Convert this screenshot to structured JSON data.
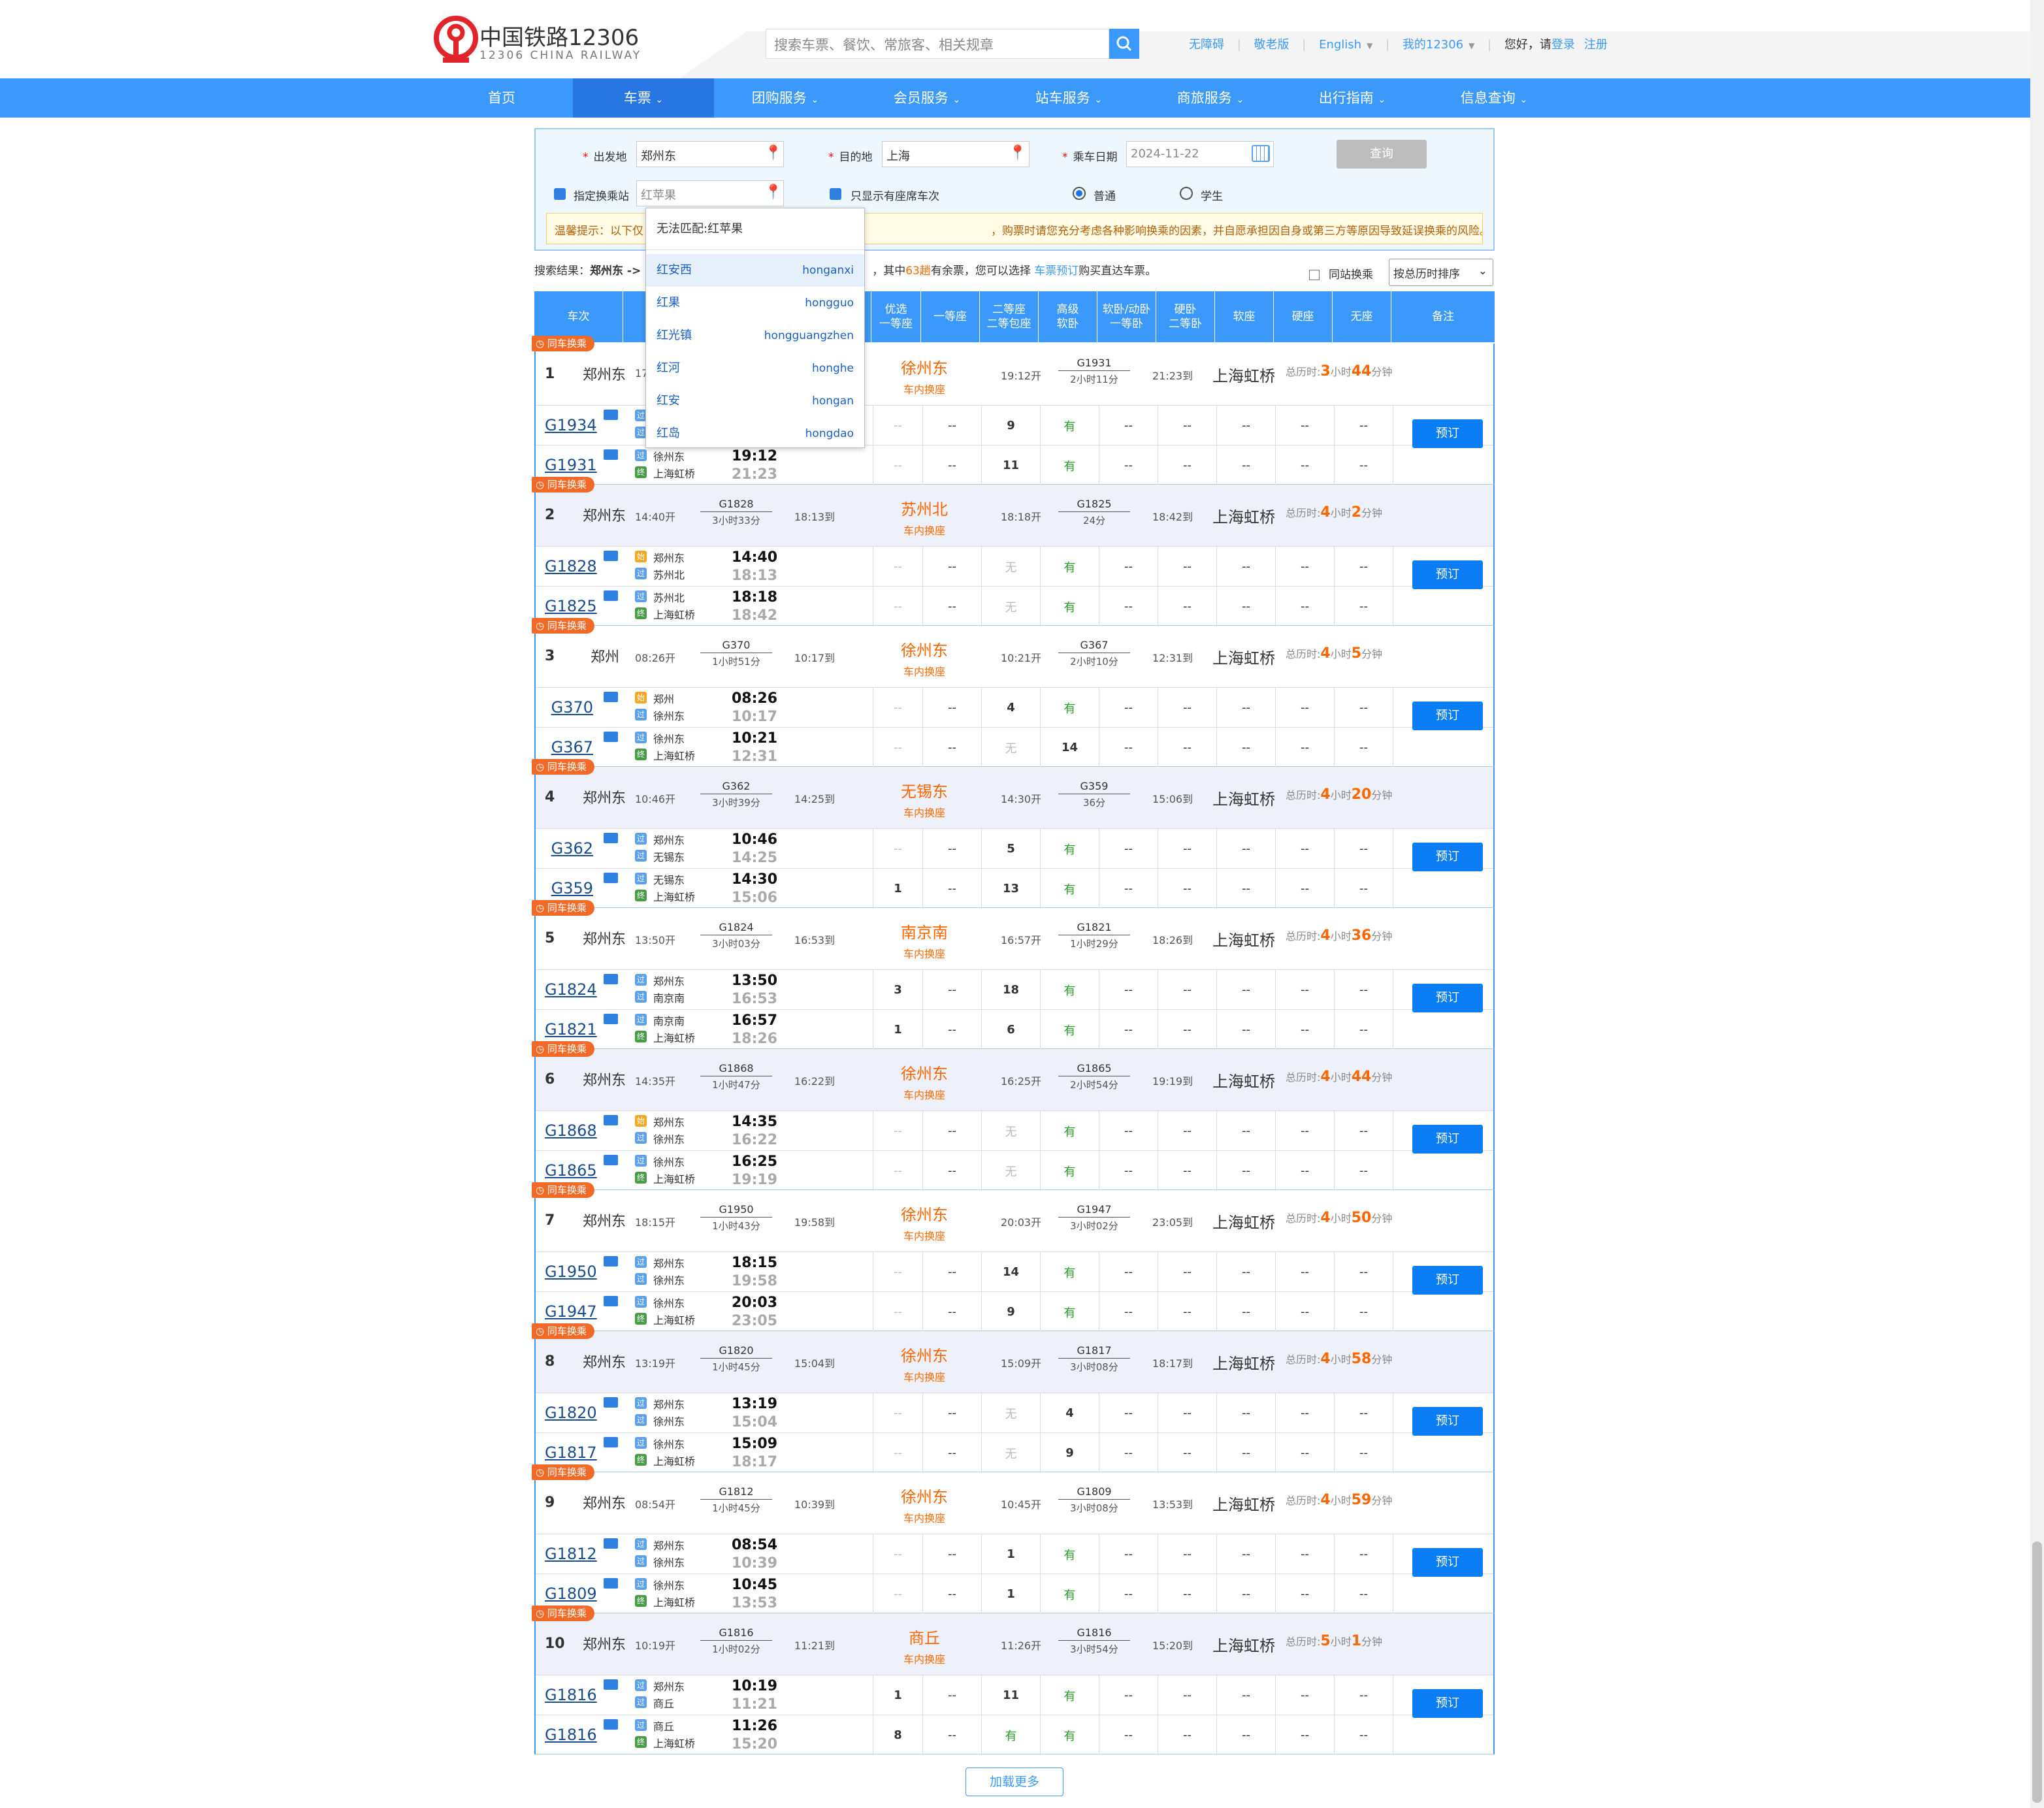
{
  "header": {
    "logo_cn": "中国铁路12306",
    "logo_en": "12306 CHINA RAILWAY",
    "search_placeholder": "搜索车票、餐饮、常旅客、相关规章",
    "links": [
      "无障碍",
      "敬老版",
      "English",
      "我的12306"
    ],
    "greeting": "您好，请",
    "login": "登录",
    "register": "注册"
  },
  "nav": [
    "首页",
    "车票",
    "团购服务",
    "会员服务",
    "站车服务",
    "商旅服务",
    "出行指南",
    "信息查询"
  ],
  "form": {
    "from_label": "出发地",
    "from_value": "郑州东",
    "to_label": "目的地",
    "to_value": "上海",
    "date_label": "乘车日期",
    "date_value": "2024-11-22",
    "query_button": "查询",
    "transfer_label": "指定换乘站",
    "transfer_value": "红苹果",
    "seat_only_label": "只显示有座席车次",
    "normal_label": "普通",
    "student_label": "学生",
    "tip": "温馨提示：以下仅",
    "tip_tail": "，购票时请您充分考虑各种影响换乘的因素，并自愿承担因自身或第三方等原因导致延误换乘的风险。"
  },
  "dropdown": {
    "header": "无法匹配:红苹果",
    "items": [
      {
        "name": "红安西",
        "py": "honganxi"
      },
      {
        "name": "红果",
        "py": "hongguo"
      },
      {
        "name": "红光镇",
        "py": "hongguangzhen"
      },
      {
        "name": "红河",
        "py": "honghe"
      },
      {
        "name": "红安",
        "py": "hongan"
      },
      {
        "name": "红岛",
        "py": "hongdao"
      }
    ]
  },
  "results": {
    "prefix": "搜索结果：",
    "route": "郑州东 ->",
    "mid1": "，其中",
    "count": "63趟",
    "mid2": "有余票，您可以选择",
    "link": "车票预订",
    "suffix": "购买直达车票。",
    "same_train_label": "同站换乘",
    "sort": "按总历时排序"
  },
  "columns": [
    "车次",
    "优选\n一等座",
    "一等座",
    "二等座\n二等包座",
    "高级\n软卧",
    "软卧/动卧\n一等卧",
    "硬卧\n二等卧",
    "软座",
    "硬座",
    "无座",
    "备注"
  ],
  "labels": {
    "badge": "同车换乘",
    "transfer_sub": "车内换座",
    "total_prefix": "总历时:",
    "dest": "上海虹桥",
    "book": "预订",
    "load_more": "加载更多"
  },
  "groups": [
    {
      "idx": "1",
      "orig": "郑州东",
      "dep": "17",
      "t1": "G1931",
      "d1": "2小时11分",
      "arr1": "",
      "xfer": "徐州东",
      "dep2": "19:12开",
      "t2": "G1931",
      "d2": "2小时11分",
      "arr2": "21:23到",
      "total_h": "3",
      "total_m": "44",
      "rows": [
        {
          "train": "G1934",
          "s1": "",
          "s2": "",
          "dt": "",
          "at": "",
          "seats": [
            "--",
            "--",
            "9",
            "有",
            "--",
            "--",
            "--",
            "--",
            "--",
            "--"
          ]
        },
        {
          "train": "G1931",
          "s1": "徐州东",
          "s2": "上海虹桥",
          "dt": "19:12",
          "at": "21:23",
          "seats": [
            "--",
            "--",
            "11",
            "有",
            "--",
            "--",
            "--",
            "--",
            "--",
            "--"
          ]
        }
      ]
    },
    {
      "idx": "2",
      "orig": "郑州东",
      "dep": "14:40开",
      "t1": "G1828",
      "d1": "3小时33分",
      "arr1": "18:13到",
      "xfer": "苏州北",
      "dep2": "18:18开",
      "t2": "G1825",
      "d2": "24分",
      "arr2": "18:42到",
      "total_h": "4",
      "total_m": "2",
      "rows": [
        {
          "train": "G1828",
          "s1": "郑州东",
          "s2": "苏州北",
          "dt": "14:40",
          "at": "18:13",
          "seats": [
            "--",
            "--",
            "无",
            "有",
            "--",
            "--",
            "--",
            "--",
            "--",
            "--"
          ]
        },
        {
          "train": "G1825",
          "s1": "苏州北",
          "s2": "上海虹桥",
          "dt": "18:18",
          "at": "18:42",
          "seats": [
            "--",
            "--",
            "无",
            "有",
            "--",
            "--",
            "--",
            "--",
            "--",
            "--"
          ]
        }
      ]
    },
    {
      "idx": "3",
      "orig": "郑州",
      "dep": "08:26开",
      "t1": "G370",
      "d1": "1小时51分",
      "arr1": "10:17到",
      "xfer": "徐州东",
      "dep2": "10:21开",
      "t2": "G367",
      "d2": "2小时10分",
      "arr2": "12:31到",
      "total_h": "4",
      "total_m": "5",
      "rows": [
        {
          "train": "G370",
          "s1": "郑州",
          "s2": "徐州东",
          "dt": "08:26",
          "at": "10:17",
          "seats": [
            "--",
            "--",
            "4",
            "有",
            "--",
            "--",
            "--",
            "--",
            "--",
            "--"
          ]
        },
        {
          "train": "G367",
          "s1": "徐州东",
          "s2": "上海虹桥",
          "dt": "10:21",
          "at": "12:31",
          "seats": [
            "--",
            "--",
            "无",
            "14",
            "--",
            "--",
            "--",
            "--",
            "--",
            "--"
          ]
        }
      ]
    },
    {
      "idx": "4",
      "orig": "郑州东",
      "dep": "10:46开",
      "t1": "G362",
      "d1": "3小时39分",
      "arr1": "14:25到",
      "xfer": "无锡东",
      "dep2": "14:30开",
      "t2": "G359",
      "d2": "36分",
      "arr2": "15:06到",
      "total_h": "4",
      "total_m": "20",
      "rows": [
        {
          "train": "G362",
          "s1": "郑州东",
          "s2": "无锡东",
          "dt": "10:46",
          "at": "14:25",
          "seats": [
            "--",
            "--",
            "5",
            "有",
            "--",
            "--",
            "--",
            "--",
            "--",
            "--"
          ]
        },
        {
          "train": "G359",
          "s1": "无锡东",
          "s2": "上海虹桥",
          "dt": "14:30",
          "at": "15:06",
          "seats": [
            "1",
            "--",
            "13",
            "有",
            "--",
            "--",
            "--",
            "--",
            "--",
            "--"
          ]
        }
      ]
    },
    {
      "idx": "5",
      "orig": "郑州东",
      "dep": "13:50开",
      "t1": "G1824",
      "d1": "3小时03分",
      "arr1": "16:53到",
      "xfer": "南京南",
      "dep2": "16:57开",
      "t2": "G1821",
      "d2": "1小时29分",
      "arr2": "18:26到",
      "total_h": "4",
      "total_m": "36",
      "rows": [
        {
          "train": "G1824",
          "s1": "郑州东",
          "s2": "南京南",
          "dt": "13:50",
          "at": "16:53",
          "seats": [
            "3",
            "--",
            "18",
            "有",
            "--",
            "--",
            "--",
            "--",
            "--",
            "--"
          ]
        },
        {
          "train": "G1821",
          "s1": "南京南",
          "s2": "上海虹桥",
          "dt": "16:57",
          "at": "18:26",
          "seats": [
            "1",
            "--",
            "6",
            "有",
            "--",
            "--",
            "--",
            "--",
            "--",
            "--"
          ]
        }
      ]
    },
    {
      "idx": "6",
      "orig": "郑州东",
      "dep": "14:35开",
      "t1": "G1868",
      "d1": "1小时47分",
      "arr1": "16:22到",
      "xfer": "徐州东",
      "dep2": "16:25开",
      "t2": "G1865",
      "d2": "2小时54分",
      "arr2": "19:19到",
      "total_h": "4",
      "total_m": "44",
      "rows": [
        {
          "train": "G1868",
          "s1": "郑州东",
          "s2": "徐州东",
          "dt": "14:35",
          "at": "16:22",
          "seats": [
            "--",
            "--",
            "无",
            "有",
            "--",
            "--",
            "--",
            "--",
            "--",
            "--"
          ]
        },
        {
          "train": "G1865",
          "s1": "徐州东",
          "s2": "上海虹桥",
          "dt": "16:25",
          "at": "19:19",
          "seats": [
            "--",
            "--",
            "无",
            "有",
            "--",
            "--",
            "--",
            "--",
            "--",
            "--"
          ]
        }
      ]
    },
    {
      "idx": "7",
      "orig": "郑州东",
      "dep": "18:15开",
      "t1": "G1950",
      "d1": "1小时43分",
      "arr1": "19:58到",
      "xfer": "徐州东",
      "dep2": "20:03开",
      "t2": "G1947",
      "d2": "3小时02分",
      "arr2": "23:05到",
      "total_h": "4",
      "total_m": "50",
      "rows": [
        {
          "train": "G1950",
          "s1": "郑州东",
          "s2": "徐州东",
          "dt": "18:15",
          "at": "19:58",
          "seats": [
            "--",
            "--",
            "14",
            "有",
            "--",
            "--",
            "--",
            "--",
            "--",
            "--"
          ]
        },
        {
          "train": "G1947",
          "s1": "徐州东",
          "s2": "上海虹桥",
          "dt": "20:03",
          "at": "23:05",
          "seats": [
            "--",
            "--",
            "9",
            "有",
            "--",
            "--",
            "--",
            "--",
            "--",
            "--"
          ]
        }
      ]
    },
    {
      "idx": "8",
      "orig": "郑州东",
      "dep": "13:19开",
      "t1": "G1820",
      "d1": "1小时45分",
      "arr1": "15:04到",
      "xfer": "徐州东",
      "dep2": "15:09开",
      "t2": "G1817",
      "d2": "3小时08分",
      "arr2": "18:17到",
      "total_h": "4",
      "total_m": "58",
      "rows": [
        {
          "train": "G1820",
          "s1": "郑州东",
          "s2": "徐州东",
          "dt": "13:19",
          "at": "15:04",
          "seats": [
            "--",
            "--",
            "无",
            "4",
            "--",
            "--",
            "--",
            "--",
            "--",
            "--"
          ]
        },
        {
          "train": "G1817",
          "s1": "徐州东",
          "s2": "上海虹桥",
          "dt": "15:09",
          "at": "18:17",
          "seats": [
            "--",
            "--",
            "无",
            "9",
            "--",
            "--",
            "--",
            "--",
            "--",
            "--"
          ]
        }
      ]
    },
    {
      "idx": "9",
      "orig": "郑州东",
      "dep": "08:54开",
      "t1": "G1812",
      "d1": "1小时45分",
      "arr1": "10:39到",
      "xfer": "徐州东",
      "dep2": "10:45开",
      "t2": "G1809",
      "d2": "3小时08分",
      "arr2": "13:53到",
      "total_h": "4",
      "total_m": "59",
      "rows": [
        {
          "train": "G1812",
          "s1": "郑州东",
          "s2": "徐州东",
          "dt": "08:54",
          "at": "10:39",
          "seats": [
            "--",
            "--",
            "1",
            "有",
            "--",
            "--",
            "--",
            "--",
            "--",
            "--"
          ]
        },
        {
          "train": "G1809",
          "s1": "徐州东",
          "s2": "上海虹桥",
          "dt": "10:45",
          "at": "13:53",
          "seats": [
            "--",
            "--",
            "1",
            "有",
            "--",
            "--",
            "--",
            "--",
            "--",
            "--"
          ]
        }
      ]
    },
    {
      "idx": "10",
      "orig": "郑州东",
      "dep": "10:19开",
      "t1": "G1816",
      "d1": "1小时02分",
      "arr1": "11:21到",
      "xfer": "商丘",
      "dep2": "11:26开",
      "t2": "G1816",
      "d2": "3小时54分",
      "arr2": "15:20到",
      "total_h": "5",
      "total_m": "1",
      "rows": [
        {
          "train": "G1816",
          "s1": "郑州东",
          "s2": "商丘",
          "dt": "10:19",
          "at": "11:21",
          "seats": [
            "1",
            "--",
            "11",
            "有",
            "--",
            "--",
            "--",
            "--",
            "--",
            "--"
          ]
        },
        {
          "train": "G1816",
          "s1": "商丘",
          "s2": "上海虹桥",
          "dt": "11:26",
          "at": "15:20",
          "seats": [
            "8",
            "--",
            "有",
            "有",
            "--",
            "--",
            "--",
            "--",
            "--",
            "--"
          ]
        }
      ]
    }
  ]
}
